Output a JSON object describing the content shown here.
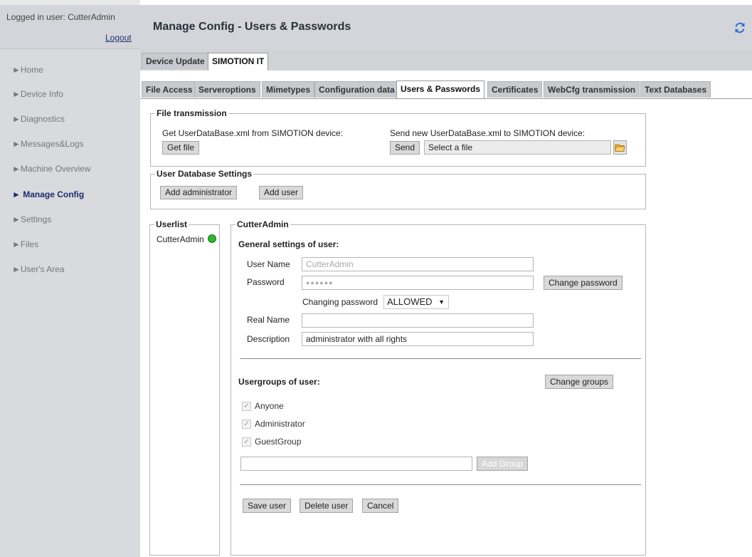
{
  "sidebar": {
    "logged_in": "Logged in user: CutterAdmin",
    "logout": "Logout",
    "items": [
      {
        "label": "►Home"
      },
      {
        "label": "►Device Info"
      },
      {
        "label": "►Diagnostics"
      },
      {
        "label": "►Messages&Logs"
      },
      {
        "label": "►Machine Overview"
      },
      {
        "label": "► Manage Config"
      },
      {
        "label": "►Settings"
      },
      {
        "label": "►Files"
      },
      {
        "label": "►User's Area"
      }
    ]
  },
  "header": {
    "title": "Manage Config - Users & Passwords",
    "refresh_icon": "refresh-icon"
  },
  "tabs_level1": [
    "Device Update",
    "SIMOTION IT"
  ],
  "tabs_level2": [
    "File Access",
    "Serveroptions",
    "Mimetypes",
    "Configuration data",
    "Users & Passwords",
    "Certificates",
    "WebCfg transmission",
    "Text Databases"
  ],
  "file_transmission": {
    "legend": "File transmission",
    "get_label": "Get UserDataBase.xml from SIMOTION device:",
    "get_button": "Get file",
    "send_label": "Send new UserDataBase.xml to SIMOTION device:",
    "send_button": "Send",
    "file_placeholder": "Select a file",
    "folder_icon": "folder-icon"
  },
  "user_db_settings": {
    "legend": "User Database Settings",
    "add_admin": "Add administrator",
    "add_user": "Add user"
  },
  "userlist": {
    "legend": "Userlist",
    "users": [
      {
        "name": "CutterAdmin",
        "status_color": "#2db82d"
      }
    ]
  },
  "user_detail": {
    "legend": "CutterAdmin",
    "general_heading": "General settings of user:",
    "user_name_label": "User Name",
    "user_name_value": "CutterAdmin",
    "password_label": "Password",
    "password_value": "●●●●●●",
    "change_password": "Change password",
    "changing_password_label": "Changing password",
    "changing_password_value": "ALLOWED",
    "real_name_label": "Real Name",
    "real_name_value": "",
    "description_label": "Description",
    "description_value": "administrator with all rights",
    "groups_heading": "Usergroups of user:",
    "change_groups": "Change groups",
    "groups": [
      {
        "label": "Anyone",
        "checked": true
      },
      {
        "label": "Administrator",
        "checked": true
      },
      {
        "label": "GuestGroup",
        "checked": true
      }
    ],
    "new_group_value": "",
    "add_group": "Add Group",
    "save_user": "Save user",
    "delete_user": "Delete user",
    "cancel": "Cancel"
  }
}
